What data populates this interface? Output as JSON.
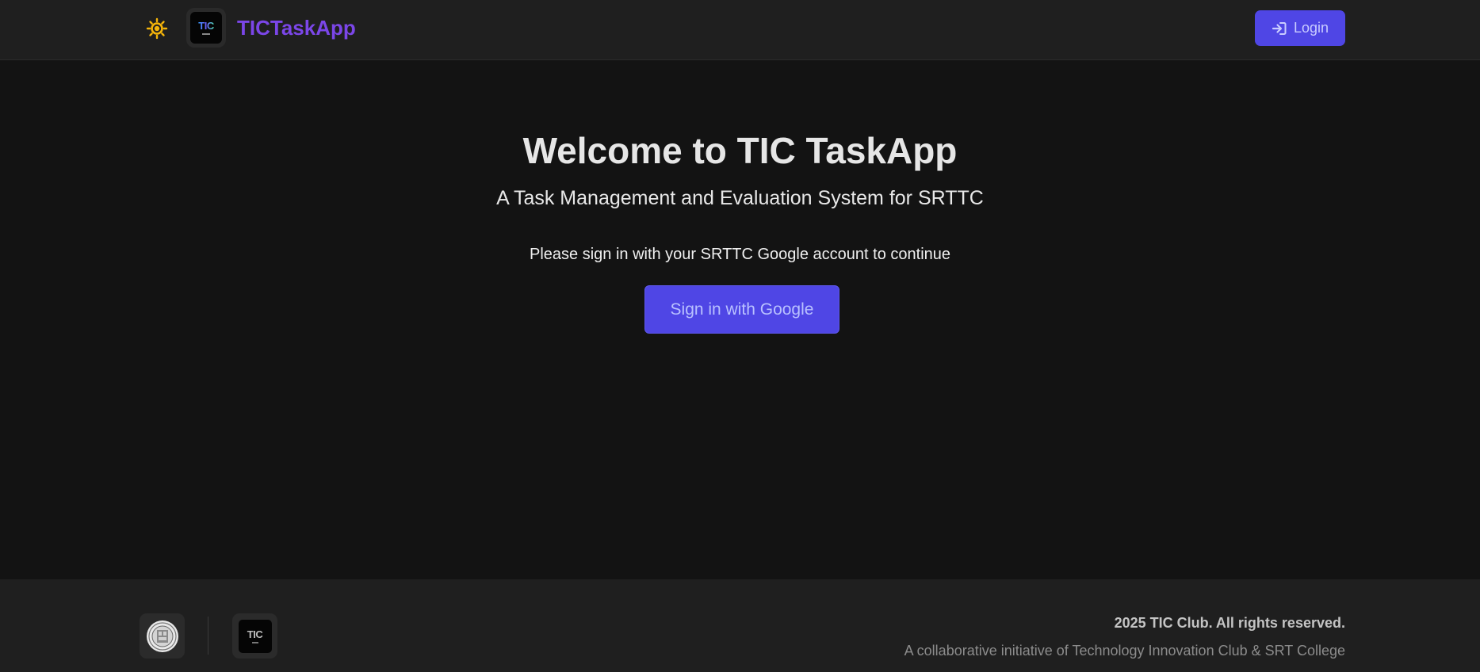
{
  "header": {
    "brand": "TICTaskApp",
    "logo_text": "TIC",
    "login_label": "Login",
    "theme_toggle_icon": "sun-icon",
    "login_icon": "sign-in-icon"
  },
  "main": {
    "title": "Welcome to TIC TaskApp",
    "subtitle": "A Task Management and Evaluation System for SRTTC",
    "prompt": "Please sign in with your SRTTC Google account to continue",
    "google_button_label": "Sign in with Google"
  },
  "footer": {
    "tic_logo_text": "TIC",
    "copyright": "2025 TIC Club. All rights reserved.",
    "initiative": "A collaborative initiative of Technology Innovation Club & SRT College"
  },
  "colors": {
    "accent": "#4f46e5",
    "brand": "#7b46e8",
    "sun": "#f5b50a",
    "background": "#131313",
    "header_bg": "#1f1f1f"
  }
}
